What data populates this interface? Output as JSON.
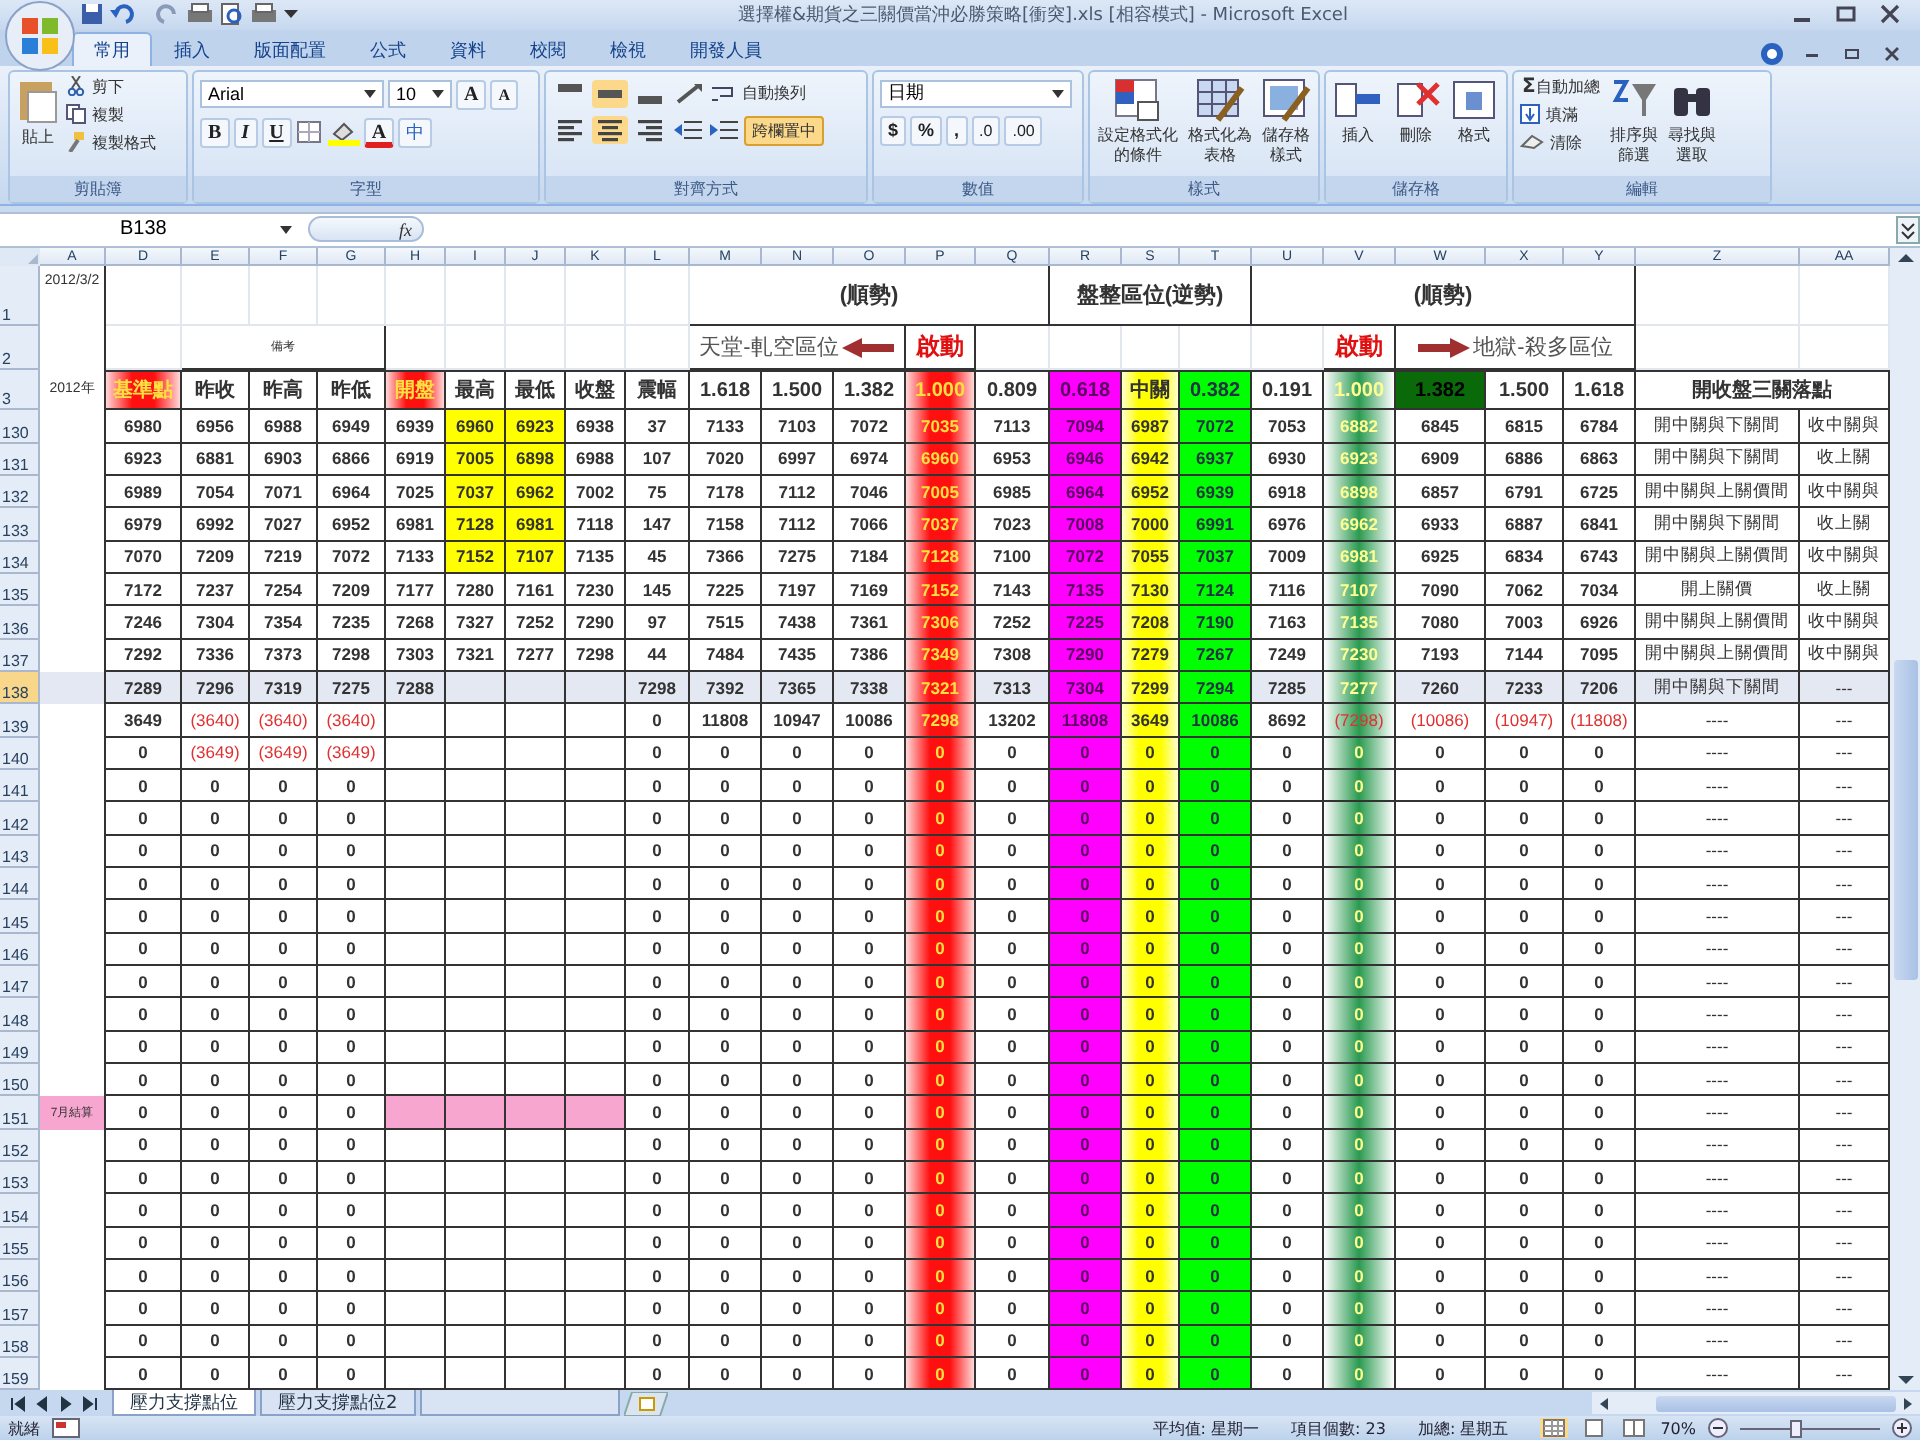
{
  "window": {
    "title": "選擇權&期貨之三關價當沖必勝策略[衝突].xls [相容模式] - Microsoft Excel"
  },
  "ribbon": {
    "tabs": [
      {
        "label": "常用",
        "selected": true
      },
      {
        "label": "插入",
        "selected": false
      },
      {
        "label": "版面配置",
        "selected": false
      },
      {
        "label": "公式",
        "selected": false
      },
      {
        "label": "資料",
        "selected": false
      },
      {
        "label": "校閱",
        "selected": false
      },
      {
        "label": "檢視",
        "selected": false
      },
      {
        "label": "開發人員",
        "selected": false
      }
    ],
    "groups": [
      {
        "kind": "clipboard",
        "label": "剪貼簿",
        "big": "貼上",
        "items": [
          "剪下",
          "複製",
          "複製格式"
        ]
      },
      {
        "kind": "font",
        "label": "字型",
        "font": "Arial",
        "size": "10",
        "grow": "A",
        "shrink": "A",
        "styles": [
          "B",
          "I",
          "U"
        ],
        "color_letter": "A",
        "phonetic": "中"
      },
      {
        "kind": "align",
        "label": "對齊方式",
        "valign": [
          {
            "selected": false
          },
          {
            "selected": true
          },
          {
            "selected": false
          }
        ],
        "halign": [
          {
            "selected": false
          },
          {
            "selected": true
          },
          {
            "selected": false
          }
        ],
        "wrap": "自動換列",
        "merge": "跨欄置中",
        "merge_on": true
      },
      {
        "kind": "number",
        "label": "數值",
        "format": "日期",
        "symbols": [
          "$",
          "%",
          ","
        ],
        "decimals": [
          ".0",
          ".00"
        ]
      },
      {
        "kind": "big",
        "label": "樣式",
        "items": [
          {
            "lines": [
              "設定格式化",
              "的條件"
            ]
          },
          {
            "lines": [
              "格式化為",
              "表格"
            ]
          },
          {
            "lines": [
              "儲存格",
              "樣式"
            ]
          }
        ]
      },
      {
        "kind": "big",
        "label": "儲存格",
        "items": [
          {
            "lines": [
              "插入"
            ]
          },
          {
            "lines": [
              "刪除"
            ]
          },
          {
            "lines": [
              "格式"
            ]
          }
        ]
      },
      {
        "kind": "editing",
        "label": "編輯",
        "small": [
          {
            "glyph": "Σ",
            "label": "自動加總"
          },
          {
            "label": "填滿"
          },
          {
            "label": "清除"
          }
        ],
        "items": [
          {
            "lines": [
              "排序與",
              "篩選"
            ]
          },
          {
            "lines": [
              "尋找與",
              "選取"
            ]
          }
        ]
      }
    ]
  },
  "formula_bar": {
    "name_box": "B138",
    "fx": "fx"
  },
  "sheet": {
    "columns": [
      {
        "letter": "A"
      },
      {
        "letter": "D"
      },
      {
        "letter": "E"
      },
      {
        "letter": "F"
      },
      {
        "letter": "G"
      },
      {
        "letter": "H"
      },
      {
        "letter": "I"
      },
      {
        "letter": "J"
      },
      {
        "letter": "K"
      },
      {
        "letter": "L"
      },
      {
        "letter": "M"
      },
      {
        "letter": "N"
      },
      {
        "letter": "O"
      },
      {
        "letter": "P",
        "kind": "red_glow"
      },
      {
        "letter": "Q"
      },
      {
        "letter": "R",
        "kind": "magenta"
      },
      {
        "letter": "S",
        "kind": "yellow_glow"
      },
      {
        "letter": "T",
        "kind": "green"
      },
      {
        "letter": "U"
      },
      {
        "letter": "V",
        "kind": "green_glow"
      },
      {
        "letter": "W"
      },
      {
        "letter": "X"
      },
      {
        "letter": "Y"
      },
      {
        "letter": "Z"
      },
      {
        "letter": "AA"
      }
    ],
    "header_rows": [
      {
        "number": "1",
        "cells": [
          "2012/3/2",
          null,
          null,
          null,
          null,
          null,
          null,
          null,
          null,
          null,
          {
            "text": "(順勢)"
          },
          {
            "merged": true
          },
          {
            "merged": true
          },
          {
            "merged": true
          },
          {
            "merged": true
          },
          {
            "text": "盤整區位(逆勢)"
          },
          {
            "merged": true
          },
          {
            "merged": true
          },
          {
            "text": "(順勢)"
          },
          {
            "merged": true
          },
          {
            "merged": true
          },
          {
            "merged": true
          },
          {
            "merged": true
          },
          null,
          null
        ]
      },
      {
        "number": "2",
        "cells": [
          null,
          null,
          {
            "text": "備考",
            "kind": "note"
          },
          {
            "merged": true
          },
          {
            "merged": true
          },
          null,
          null,
          null,
          null,
          null,
          {
            "text": "天堂-軋空區位",
            "kind": "arrow_left"
          },
          {
            "merged": true
          },
          {
            "merged": true
          },
          {
            "text": "啟動",
            "kind": "alert"
          },
          null,
          null,
          null,
          null,
          null,
          {
            "text": "啟動",
            "kind": "alert"
          },
          {
            "text": "地獄-殺多區位",
            "kind": "arrow_right"
          },
          {
            "merged": true
          },
          {
            "merged": true
          },
          null,
          null
        ]
      },
      {
        "number": "3",
        "cells": [
          "2012年",
          {
            "text": "基準點",
            "kind": "red_glow"
          },
          "昨收",
          "昨高",
          "昨低",
          {
            "text": "開盤",
            "kind": "red_glow"
          },
          "最高",
          "最低",
          "收盤",
          "震幅",
          "1.618",
          "1.500",
          "1.382",
          {
            "text": "1.000",
            "kind": "red_glow"
          },
          "0.809",
          {
            "text": "0.618",
            "kind": "magenta"
          },
          {
            "text": "中關",
            "kind": "yellow_glow"
          },
          {
            "text": "0.382",
            "kind": "green"
          },
          "0.191",
          {
            "text": "1.000",
            "kind": "green_glow"
          },
          {
            "text": "1.382",
            "kind": "dark_green"
          },
          "1.500",
          "1.618",
          {
            "text": "開收盤三關落點"
          },
          {
            "merged": true
          }
        ]
      }
    ],
    "rows": [
      {
        "number": "130",
        "selected": false,
        "cells": [
          null,
          "6980",
          "6956",
          "6988",
          "6949",
          "6939",
          {
            "text": "6960",
            "color": "#ffff00"
          },
          {
            "text": "6923",
            "color": "#ffff00"
          },
          "6938",
          "37",
          "7133",
          "7103",
          "7072",
          "7035",
          "7113",
          "7094",
          "6987",
          "7072",
          "7053",
          "6882",
          "6845",
          "6815",
          "6784",
          "開中關與下關間",
          "收中關與"
        ]
      },
      {
        "number": "131",
        "selected": false,
        "cells": [
          null,
          "6923",
          "6881",
          "6903",
          "6866",
          "6919",
          {
            "text": "7005",
            "color": "#ffff00"
          },
          {
            "text": "6898",
            "color": "#ffff00"
          },
          "6988",
          "107",
          "7020",
          "6997",
          "6974",
          "6960",
          "6953",
          "6946",
          "6942",
          "6937",
          "6930",
          "6923",
          "6909",
          "6886",
          "6863",
          "開中關與下關間",
          "收上關"
        ]
      },
      {
        "number": "132",
        "selected": false,
        "cells": [
          null,
          "6989",
          "7054",
          "7071",
          "6964",
          "7025",
          {
            "text": "7037",
            "color": "#ffff00"
          },
          {
            "text": "6962",
            "color": "#ffff00"
          },
          "7002",
          "75",
          "7178",
          "7112",
          "7046",
          "7005",
          "6985",
          "6964",
          "6952",
          "6939",
          "6918",
          "6898",
          "6857",
          "6791",
          "6725",
          "開中關與上關價間",
          "收中關與"
        ]
      },
      {
        "number": "133",
        "selected": false,
        "cells": [
          null,
          "6979",
          "6992",
          "7027",
          "6952",
          "6981",
          {
            "text": "7128",
            "color": "#ffff00"
          },
          {
            "text": "6981",
            "color": "#ffff00"
          },
          "7118",
          "147",
          "7158",
          "7112",
          "7066",
          "7037",
          "7023",
          "7008",
          "7000",
          "6991",
          "6976",
          "6962",
          "6933",
          "6887",
          "6841",
          "開中關與下關間",
          "收上關"
        ]
      },
      {
        "number": "134",
        "selected": false,
        "cells": [
          null,
          "7070",
          "7209",
          "7219",
          "7072",
          "7133",
          {
            "text": "7152",
            "color": "#ffff00"
          },
          {
            "text": "7107",
            "color": "#ffff00"
          },
          "7135",
          "45",
          "7366",
          "7275",
          "7184",
          "7128",
          "7100",
          "7072",
          "7055",
          "7037",
          "7009",
          "6981",
          "6925",
          "6834",
          "6743",
          "開中關與上關價間",
          "收中關與"
        ]
      },
      {
        "number": "135",
        "selected": false,
        "cells": [
          null,
          "7172",
          "7237",
          "7254",
          "7209",
          "7177",
          "7280",
          "7161",
          "7230",
          "145",
          "7225",
          "7197",
          "7169",
          "7152",
          "7143",
          "7135",
          "7130",
          "7124",
          "7116",
          "7107",
          "7090",
          "7062",
          "7034",
          "開上關價",
          "收上關"
        ]
      },
      {
        "number": "136",
        "selected": false,
        "cells": [
          null,
          "7246",
          "7304",
          "7354",
          "7235",
          "7268",
          "7327",
          "7252",
          "7290",
          "97",
          "7515",
          "7438",
          "7361",
          "7306",
          "7252",
          "7225",
          "7208",
          "7190",
          "7163",
          "7135",
          "7080",
          "7003",
          "6926",
          "開中關與上關價間",
          "收中關與"
        ]
      },
      {
        "number": "137",
        "selected": false,
        "cells": [
          null,
          "7292",
          "7336",
          "7373",
          "7298",
          "7303",
          "7321",
          "7277",
          "7298",
          "44",
          "7484",
          "7435",
          "7386",
          "7349",
          "7308",
          "7290",
          "7279",
          "7267",
          "7249",
          "7230",
          "7193",
          "7144",
          "7095",
          "開中關與上關價間",
          "收中關與"
        ]
      },
      {
        "number": "138",
        "selected": true,
        "cells": [
          null,
          "7289",
          "7296",
          "7319",
          "7275",
          "7288",
          null,
          null,
          null,
          "7298",
          "7392",
          "7365",
          "7338",
          "7321",
          "7313",
          "7304",
          "7299",
          "7294",
          "7285",
          "7277",
          "7260",
          "7233",
          "7206",
          "開中關與下關間",
          "---"
        ]
      },
      {
        "number": "139",
        "selected": false,
        "cells": [
          null,
          "3649",
          {
            "text": "(3640)",
            "negative": true
          },
          {
            "text": "(3640)",
            "negative": true
          },
          {
            "text": "(3640)",
            "negative": true
          },
          null,
          null,
          null,
          null,
          "0",
          "11808",
          "10947",
          "10086",
          "7298",
          "13202",
          "11808",
          "3649",
          "10086",
          "8692",
          {
            "text": "(7298)",
            "negative": true
          },
          {
            "text": "(10086)",
            "negative": true
          },
          {
            "text": "(10947)",
            "negative": true
          },
          {
            "text": "(11808)",
            "negative": true
          },
          "----",
          "---"
        ]
      },
      {
        "number": "140",
        "selected": false,
        "cells": [
          null,
          "0",
          {
            "text": "(3649)",
            "negative": true
          },
          {
            "text": "(3649)",
            "negative": true
          },
          {
            "text": "(3649)",
            "negative": true
          },
          null,
          null,
          null,
          null,
          "0",
          "0",
          "0",
          "0",
          "0",
          "0",
          "0",
          "0",
          "0",
          "0",
          "0",
          "0",
          "0",
          "0",
          "----",
          "---"
        ]
      },
      {
        "number": "141",
        "selected": false,
        "cells": [
          null,
          "0",
          "0",
          "0",
          "0",
          null,
          null,
          null,
          null,
          "0",
          "0",
          "0",
          "0",
          "0",
          "0",
          "0",
          "0",
          "0",
          "0",
          "0",
          "0",
          "0",
          "0",
          "----",
          "---"
        ]
      },
      {
        "number": "142",
        "selected": false,
        "cells": [
          null,
          "0",
          "0",
          "0",
          "0",
          null,
          null,
          null,
          null,
          "0",
          "0",
          "0",
          "0",
          "0",
          "0",
          "0",
          "0",
          "0",
          "0",
          "0",
          "0",
          "0",
          "0",
          "----",
          "---"
        ]
      },
      {
        "number": "143",
        "selected": false,
        "cells": [
          null,
          "0",
          "0",
          "0",
          "0",
          null,
          null,
          null,
          null,
          "0",
          "0",
          "0",
          "0",
          "0",
          "0",
          "0",
          "0",
          "0",
          "0",
          "0",
          "0",
          "0",
          "0",
          "----",
          "---"
        ]
      },
      {
        "number": "144",
        "selected": false,
        "cells": [
          null,
          "0",
          "0",
          "0",
          "0",
          null,
          null,
          null,
          null,
          "0",
          "0",
          "0",
          "0",
          "0",
          "0",
          "0",
          "0",
          "0",
          "0",
          "0",
          "0",
          "0",
          "0",
          "----",
          "---"
        ]
      },
      {
        "number": "145",
        "selected": false,
        "cells": [
          null,
          "0",
          "0",
          "0",
          "0",
          null,
          null,
          null,
          null,
          "0",
          "0",
          "0",
          "0",
          "0",
          "0",
          "0",
          "0",
          "0",
          "0",
          "0",
          "0",
          "0",
          "0",
          "----",
          "---"
        ]
      },
      {
        "number": "146",
        "selected": false,
        "cells": [
          null,
          "0",
          "0",
          "0",
          "0",
          null,
          null,
          null,
          null,
          "0",
          "0",
          "0",
          "0",
          "0",
          "0",
          "0",
          "0",
          "0",
          "0",
          "0",
          "0",
          "0",
          "0",
          "----",
          "---"
        ]
      },
      {
        "number": "147",
        "selected": false,
        "cells": [
          null,
          "0",
          "0",
          "0",
          "0",
          null,
          null,
          null,
          null,
          "0",
          "0",
          "0",
          "0",
          "0",
          "0",
          "0",
          "0",
          "0",
          "0",
          "0",
          "0",
          "0",
          "0",
          "----",
          "---"
        ]
      },
      {
        "number": "148",
        "selected": false,
        "cells": [
          null,
          "0",
          "0",
          "0",
          "0",
          null,
          null,
          null,
          null,
          "0",
          "0",
          "0",
          "0",
          "0",
          "0",
          "0",
          "0",
          "0",
          "0",
          "0",
          "0",
          "0",
          "0",
          "----",
          "---"
        ]
      },
      {
        "number": "149",
        "selected": false,
        "cells": [
          null,
          "0",
          "0",
          "0",
          "0",
          null,
          null,
          null,
          null,
          "0",
          "0",
          "0",
          "0",
          "0",
          "0",
          "0",
          "0",
          "0",
          "0",
          "0",
          "0",
          "0",
          "0",
          "----",
          "---"
        ]
      },
      {
        "number": "150",
        "selected": false,
        "cells": [
          null,
          "0",
          "0",
          "0",
          "0",
          null,
          null,
          null,
          null,
          "0",
          "0",
          "0",
          "0",
          "0",
          "0",
          "0",
          "0",
          "0",
          "0",
          "0",
          "0",
          "0",
          "0",
          "----",
          "---"
        ]
      },
      {
        "number": "151",
        "selected": false,
        "cells": [
          {
            "text": "7月結算",
            "color": "#f7a6d0"
          },
          "0",
          "0",
          "0",
          "0",
          {
            "color": "#f7a6d0"
          },
          {
            "color": "#f7a6d0"
          },
          {
            "color": "#f7a6d0"
          },
          {
            "color": "#f7a6d0"
          },
          "0",
          "0",
          "0",
          "0",
          "0",
          "0",
          "0",
          "0",
          "0",
          "0",
          "0",
          "0",
          "0",
          "0",
          "----",
          "---"
        ]
      },
      {
        "number": "152",
        "selected": false,
        "cells": [
          null,
          "0",
          "0",
          "0",
          "0",
          null,
          null,
          null,
          null,
          "0",
          "0",
          "0",
          "0",
          "0",
          "0",
          "0",
          "0",
          "0",
          "0",
          "0",
          "0",
          "0",
          "0",
          "----",
          "---"
        ]
      },
      {
        "number": "153",
        "selected": false,
        "cells": [
          null,
          "0",
          "0",
          "0",
          "0",
          null,
          null,
          null,
          null,
          "0",
          "0",
          "0",
          "0",
          "0",
          "0",
          "0",
          "0",
          "0",
          "0",
          "0",
          "0",
          "0",
          "0",
          "----",
          "---"
        ]
      },
      {
        "number": "154",
        "selected": false,
        "cells": [
          null,
          "0",
          "0",
          "0",
          "0",
          null,
          null,
          null,
          null,
          "0",
          "0",
          "0",
          "0",
          "0",
          "0",
          "0",
          "0",
          "0",
          "0",
          "0",
          "0",
          "0",
          "0",
          "----",
          "---"
        ]
      },
      {
        "number": "155",
        "selected": false,
        "cells": [
          null,
          "0",
          "0",
          "0",
          "0",
          null,
          null,
          null,
          null,
          "0",
          "0",
          "0",
          "0",
          "0",
          "0",
          "0",
          "0",
          "0",
          "0",
          "0",
          "0",
          "0",
          "0",
          "----",
          "---"
        ]
      },
      {
        "number": "156",
        "selected": false,
        "cells": [
          null,
          "0",
          "0",
          "0",
          "0",
          null,
          null,
          null,
          null,
          "0",
          "0",
          "0",
          "0",
          "0",
          "0",
          "0",
          "0",
          "0",
          "0",
          "0",
          "0",
          "0",
          "0",
          "----",
          "---"
        ]
      },
      {
        "number": "157",
        "selected": false,
        "cells": [
          null,
          "0",
          "0",
          "0",
          "0",
          null,
          null,
          null,
          null,
          "0",
          "0",
          "0",
          "0",
          "0",
          "0",
          "0",
          "0",
          "0",
          "0",
          "0",
          "0",
          "0",
          "0",
          "----",
          "---"
        ]
      },
      {
        "number": "158",
        "selected": false,
        "cells": [
          null,
          "0",
          "0",
          "0",
          "0",
          null,
          null,
          null,
          null,
          "0",
          "0",
          "0",
          "0",
          "0",
          "0",
          "0",
          "0",
          "0",
          "0",
          "0",
          "0",
          "0",
          "0",
          "----",
          "---"
        ]
      },
      {
        "number": "159",
        "selected": false,
        "cells": [
          null,
          "0",
          "0",
          "0",
          "0",
          null,
          null,
          null,
          null,
          "0",
          "0",
          "0",
          "0",
          "0",
          "0",
          "0",
          "0",
          "0",
          "0",
          "0",
          "0",
          "0",
          "0",
          "----",
          "---"
        ]
      }
    ]
  },
  "sheet_tabs": [
    {
      "label": "壓力支撐點位",
      "selected": true
    },
    {
      "label": "壓力支撐點位2",
      "selected": false
    },
    {
      "selected": false
    }
  ],
  "status_bar": {
    "mode": "就緒",
    "stats": [
      "平均值: 星期一",
      "項目個數: 23",
      "加總: 星期五"
    ],
    "zoom": "70%",
    "zoom_slider": {
      "level": 0.4
    }
  }
}
